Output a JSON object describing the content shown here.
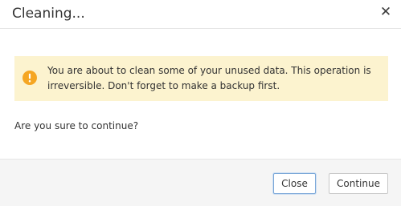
{
  "dialog": {
    "title": "Cleaning...",
    "close_icon": "close-icon",
    "alert": {
      "icon": "exclamation-circle-icon",
      "icon_color": "#f5a623",
      "background": "#fcf3cf",
      "message": "You are about to clean some of your unused data. This operation is irreversible. Don't forget to make a backup first."
    },
    "question": "Are you sure to continue?",
    "buttons": {
      "close_label": "Close",
      "continue_label": "Continue"
    }
  }
}
